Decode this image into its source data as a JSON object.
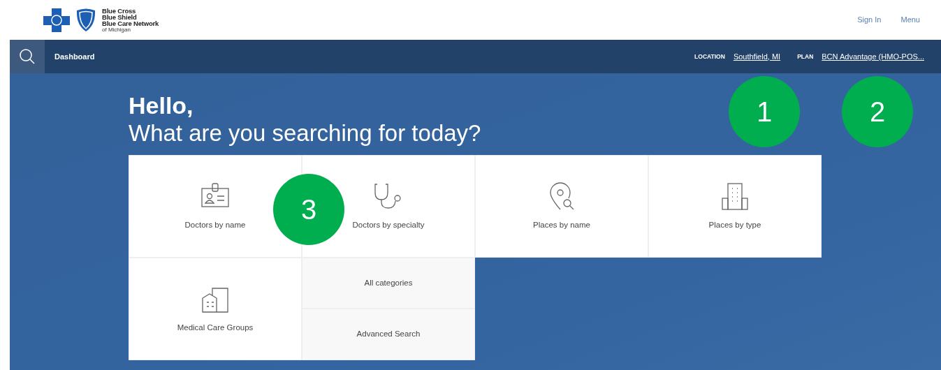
{
  "logo": {
    "lines": [
      "Blue Cross",
      "Blue Shield",
      "Blue Care Network"
    ],
    "subline": "of Michigan"
  },
  "header_links": [
    "Sign In",
    "Menu"
  ],
  "navbar": {
    "title": "Dashboard",
    "location_label": "LOCATION",
    "location": "Southfield, MI",
    "plan_label": "PLAN",
    "plan": "BCN Advantage (HMO-POS..."
  },
  "hero": {
    "greeting": "Hello,",
    "question": "What are you searching for today?"
  },
  "tiles": [
    {
      "kind": "icon",
      "label": "Doctors by name"
    },
    {
      "kind": "icon",
      "label": "Doctors by specialty"
    },
    {
      "kind": "icon",
      "label": "Places by name"
    },
    {
      "kind": "icon",
      "label": "Places by type"
    },
    {
      "kind": "icon",
      "label": "Medical Care Groups"
    },
    {
      "kind": "links",
      "links": [
        "All categories",
        "Advanced Search"
      ]
    }
  ],
  "callouts": [
    {
      "label": "1"
    },
    {
      "label": "2"
    },
    {
      "label": "3"
    }
  ]
}
